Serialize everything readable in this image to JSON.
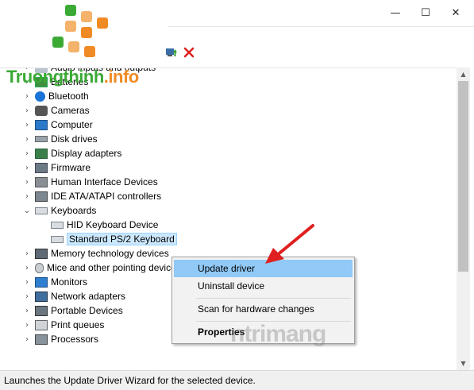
{
  "window": {
    "buttons": {
      "minimize": "—",
      "maximize": "☐",
      "close": "✕"
    }
  },
  "toolbar": {
    "update_icon": "update-driver-icon",
    "remove_icon": "uninstall-icon"
  },
  "logo": {
    "text_main": "Truongthinh",
    "text_suffix": ".info",
    "green": "#3aaa35",
    "orange": "#f08a24"
  },
  "tree": {
    "items": [
      {
        "label": "Audio inputs and outputs",
        "icon": "audio-icon",
        "chev": "›"
      },
      {
        "label": "Batteries",
        "icon": "battery-icon",
        "chev": "›"
      },
      {
        "label": "Bluetooth",
        "icon": "bluetooth-icon",
        "chev": "›"
      },
      {
        "label": "Cameras",
        "icon": "camera-icon",
        "chev": "›"
      },
      {
        "label": "Computer",
        "icon": "computer-icon",
        "chev": "›"
      },
      {
        "label": "Disk drives",
        "icon": "disk-icon",
        "chev": "›"
      },
      {
        "label": "Display adapters",
        "icon": "display-icon",
        "chev": "›"
      },
      {
        "label": "Firmware",
        "icon": "firmware-icon",
        "chev": "›"
      },
      {
        "label": "Human Interface Devices",
        "icon": "hid-icon",
        "chev": "›"
      },
      {
        "label": "IDE ATA/ATAPI controllers",
        "icon": "ide-icon",
        "chev": "›"
      },
      {
        "label": "Keyboards",
        "icon": "keyboard-icon",
        "chev": "⌄"
      },
      {
        "label": "HID Keyboard Device",
        "icon": "keyboard-icon",
        "chev": ""
      },
      {
        "label": "Standard PS/2 Keyboard",
        "icon": "keyboard-icon",
        "chev": ""
      },
      {
        "label": "Memory technology devices",
        "icon": "memory-icon",
        "chev": "›"
      },
      {
        "label": "Mice and other pointing devices",
        "icon": "mouse-icon",
        "chev": "›"
      },
      {
        "label": "Monitors",
        "icon": "monitor-icon",
        "chev": "›"
      },
      {
        "label": "Network adapters",
        "icon": "network-icon",
        "chev": "›"
      },
      {
        "label": "Portable Devices",
        "icon": "portable-icon",
        "chev": "›"
      },
      {
        "label": "Print queues",
        "icon": "printer-icon",
        "chev": "›"
      },
      {
        "label": "Processors",
        "icon": "cpu-icon",
        "chev": "›"
      }
    ]
  },
  "context_menu": {
    "update": "Update driver",
    "uninstall": "Uninstall device",
    "scan": "Scan for hardware changes",
    "properties": "Properties"
  },
  "status": {
    "text": "Launches the Update Driver Wizard for the selected device."
  },
  "watermark": {
    "text": "ntrimang"
  }
}
